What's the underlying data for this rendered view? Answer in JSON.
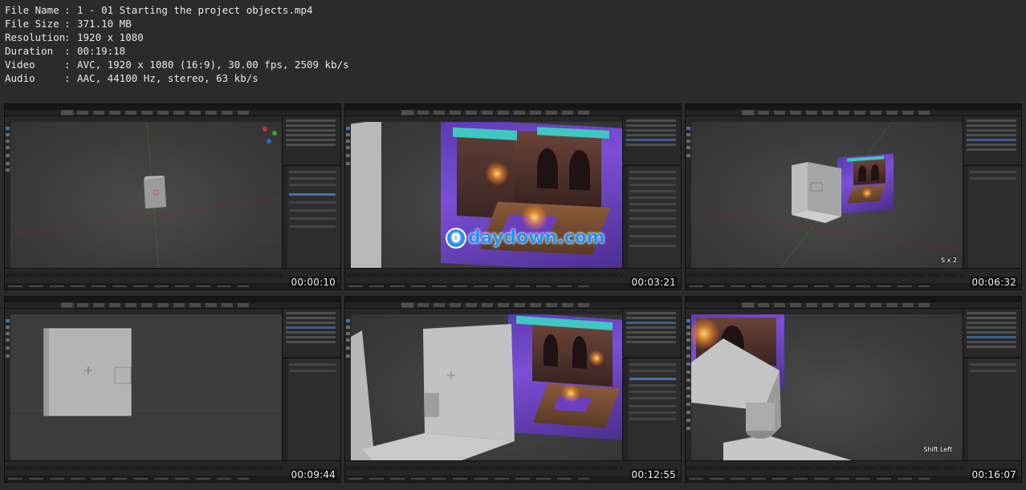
{
  "file_info": [
    {
      "label": "File Name",
      "value": "1 - 01 Starting the project objects.mp4"
    },
    {
      "label": "File Size",
      "value": "371.10 MB"
    },
    {
      "label": "Resolution",
      "value": "1920 x 1080"
    },
    {
      "label": "Duration",
      "value": "00:19:18"
    },
    {
      "label": "Video",
      "value": "AVC, 1920 x 1080 (16:9), 30.00 fps, 2509 kb/s"
    },
    {
      "label": "Audio",
      "value": "AAC, 44100 Hz, stereo, 63 kb/s"
    }
  ],
  "separator": ":",
  "thumbnails": [
    {
      "timestamp": "00:00:10"
    },
    {
      "timestamp": "00:03:21",
      "watermark_glyph": "0",
      "watermark": "daydown.com"
    },
    {
      "timestamp": "00:06:32",
      "overlay": "S x 2"
    },
    {
      "timestamp": "00:09:44"
    },
    {
      "timestamp": "00:12:55"
    },
    {
      "timestamp": "00:16:07",
      "overlay": "Shift Left"
    }
  ],
  "colors": {
    "background": "#2b2b2b",
    "blender_ui": "#1d1d1d",
    "selection_blue": "#4772b3",
    "dungeon_purple": "#7b4fd6",
    "tile_cyan": "#3fc7c2",
    "watermark_blue": "#2a8ff0"
  },
  "icons": [
    "navigation-gizmo-icon",
    "tool-icon",
    "watermark-logo-icon"
  ]
}
